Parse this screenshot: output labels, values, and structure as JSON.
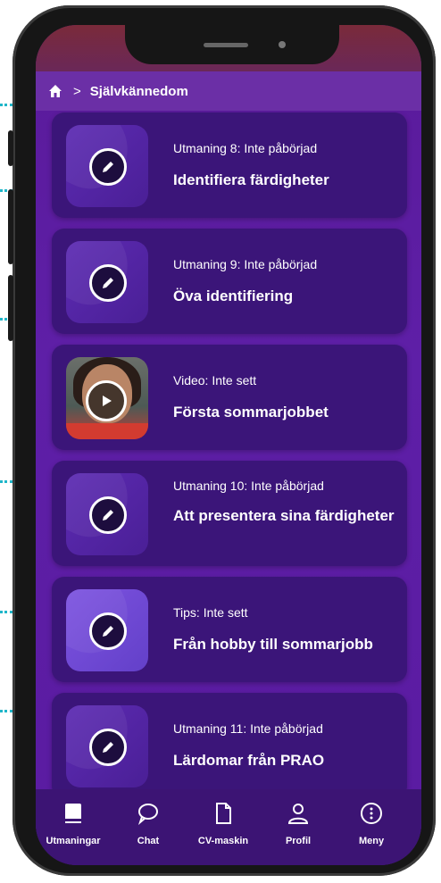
{
  "breadcrumb": {
    "home_icon": "home-icon",
    "separator": ">",
    "current": "Självkännedom"
  },
  "cards": [
    {
      "meta": "Utmaning 8: Inte påbörjad",
      "title": "Identifiera färdigheter",
      "icon": "pencil-icon"
    },
    {
      "meta": "Utmaning 9: Inte påbörjad",
      "title": "Öva identifiering",
      "icon": "pencil-icon"
    },
    {
      "meta": "Video: Inte sett",
      "title": "Första sommarjobbet",
      "icon": "play-icon"
    },
    {
      "meta": "Utmaning 10: Inte påbörjad",
      "title": "Att presentera sina färdigheter",
      "icon": "pencil-icon"
    },
    {
      "meta": "Tips: Inte sett",
      "title": "Från hobby till sommarjobb",
      "icon": "pencil-icon"
    },
    {
      "meta": "Utmaning 11: Inte påbörjad",
      "title": "Lärdomar från PRAO",
      "icon": "pencil-icon"
    }
  ],
  "tabs": [
    {
      "label": "Utmaningar",
      "icon": "book-icon"
    },
    {
      "label": "Chat",
      "icon": "chat-bubble-icon"
    },
    {
      "label": "CV-maskin",
      "icon": "document-icon"
    },
    {
      "label": "Profil",
      "icon": "person-icon"
    },
    {
      "label": "Meny",
      "icon": "more-icon"
    }
  ],
  "colors": {
    "accent": "#5e1fa7",
    "card": "#3b1579",
    "tabbar": "#3c1474",
    "annotation": "#1fb6c9"
  }
}
